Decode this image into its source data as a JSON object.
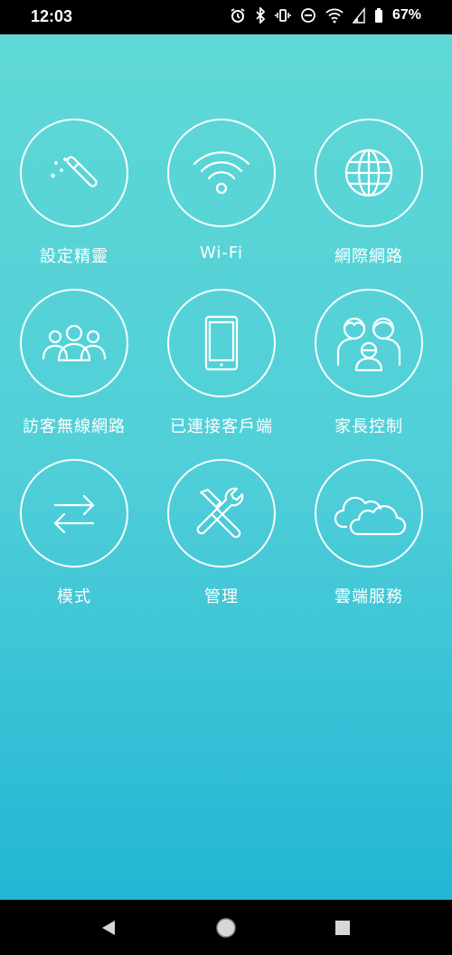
{
  "status_bar": {
    "time": "12:03",
    "battery": "67%"
  },
  "grid": [
    {
      "label": "設定精靈",
      "icon": "magic-wand-icon"
    },
    {
      "label": "Wi-Fi",
      "icon": "wifi-icon"
    },
    {
      "label": "網際網路",
      "icon": "globe-icon"
    },
    {
      "label": "訪客無線網路",
      "icon": "guest-users-icon"
    },
    {
      "label": "已連接客戶端",
      "icon": "tablet-icon"
    },
    {
      "label": "家長控制",
      "icon": "family-icon"
    },
    {
      "label": "模式",
      "icon": "swap-arrows-icon"
    },
    {
      "label": "管理",
      "icon": "tools-icon"
    },
    {
      "label": "雲端服務",
      "icon": "cloud-icon"
    }
  ],
  "colors": {
    "gradient_top": "#5fd8d6",
    "gradient_bottom": "#23b6d4",
    "bars": "#000000"
  }
}
